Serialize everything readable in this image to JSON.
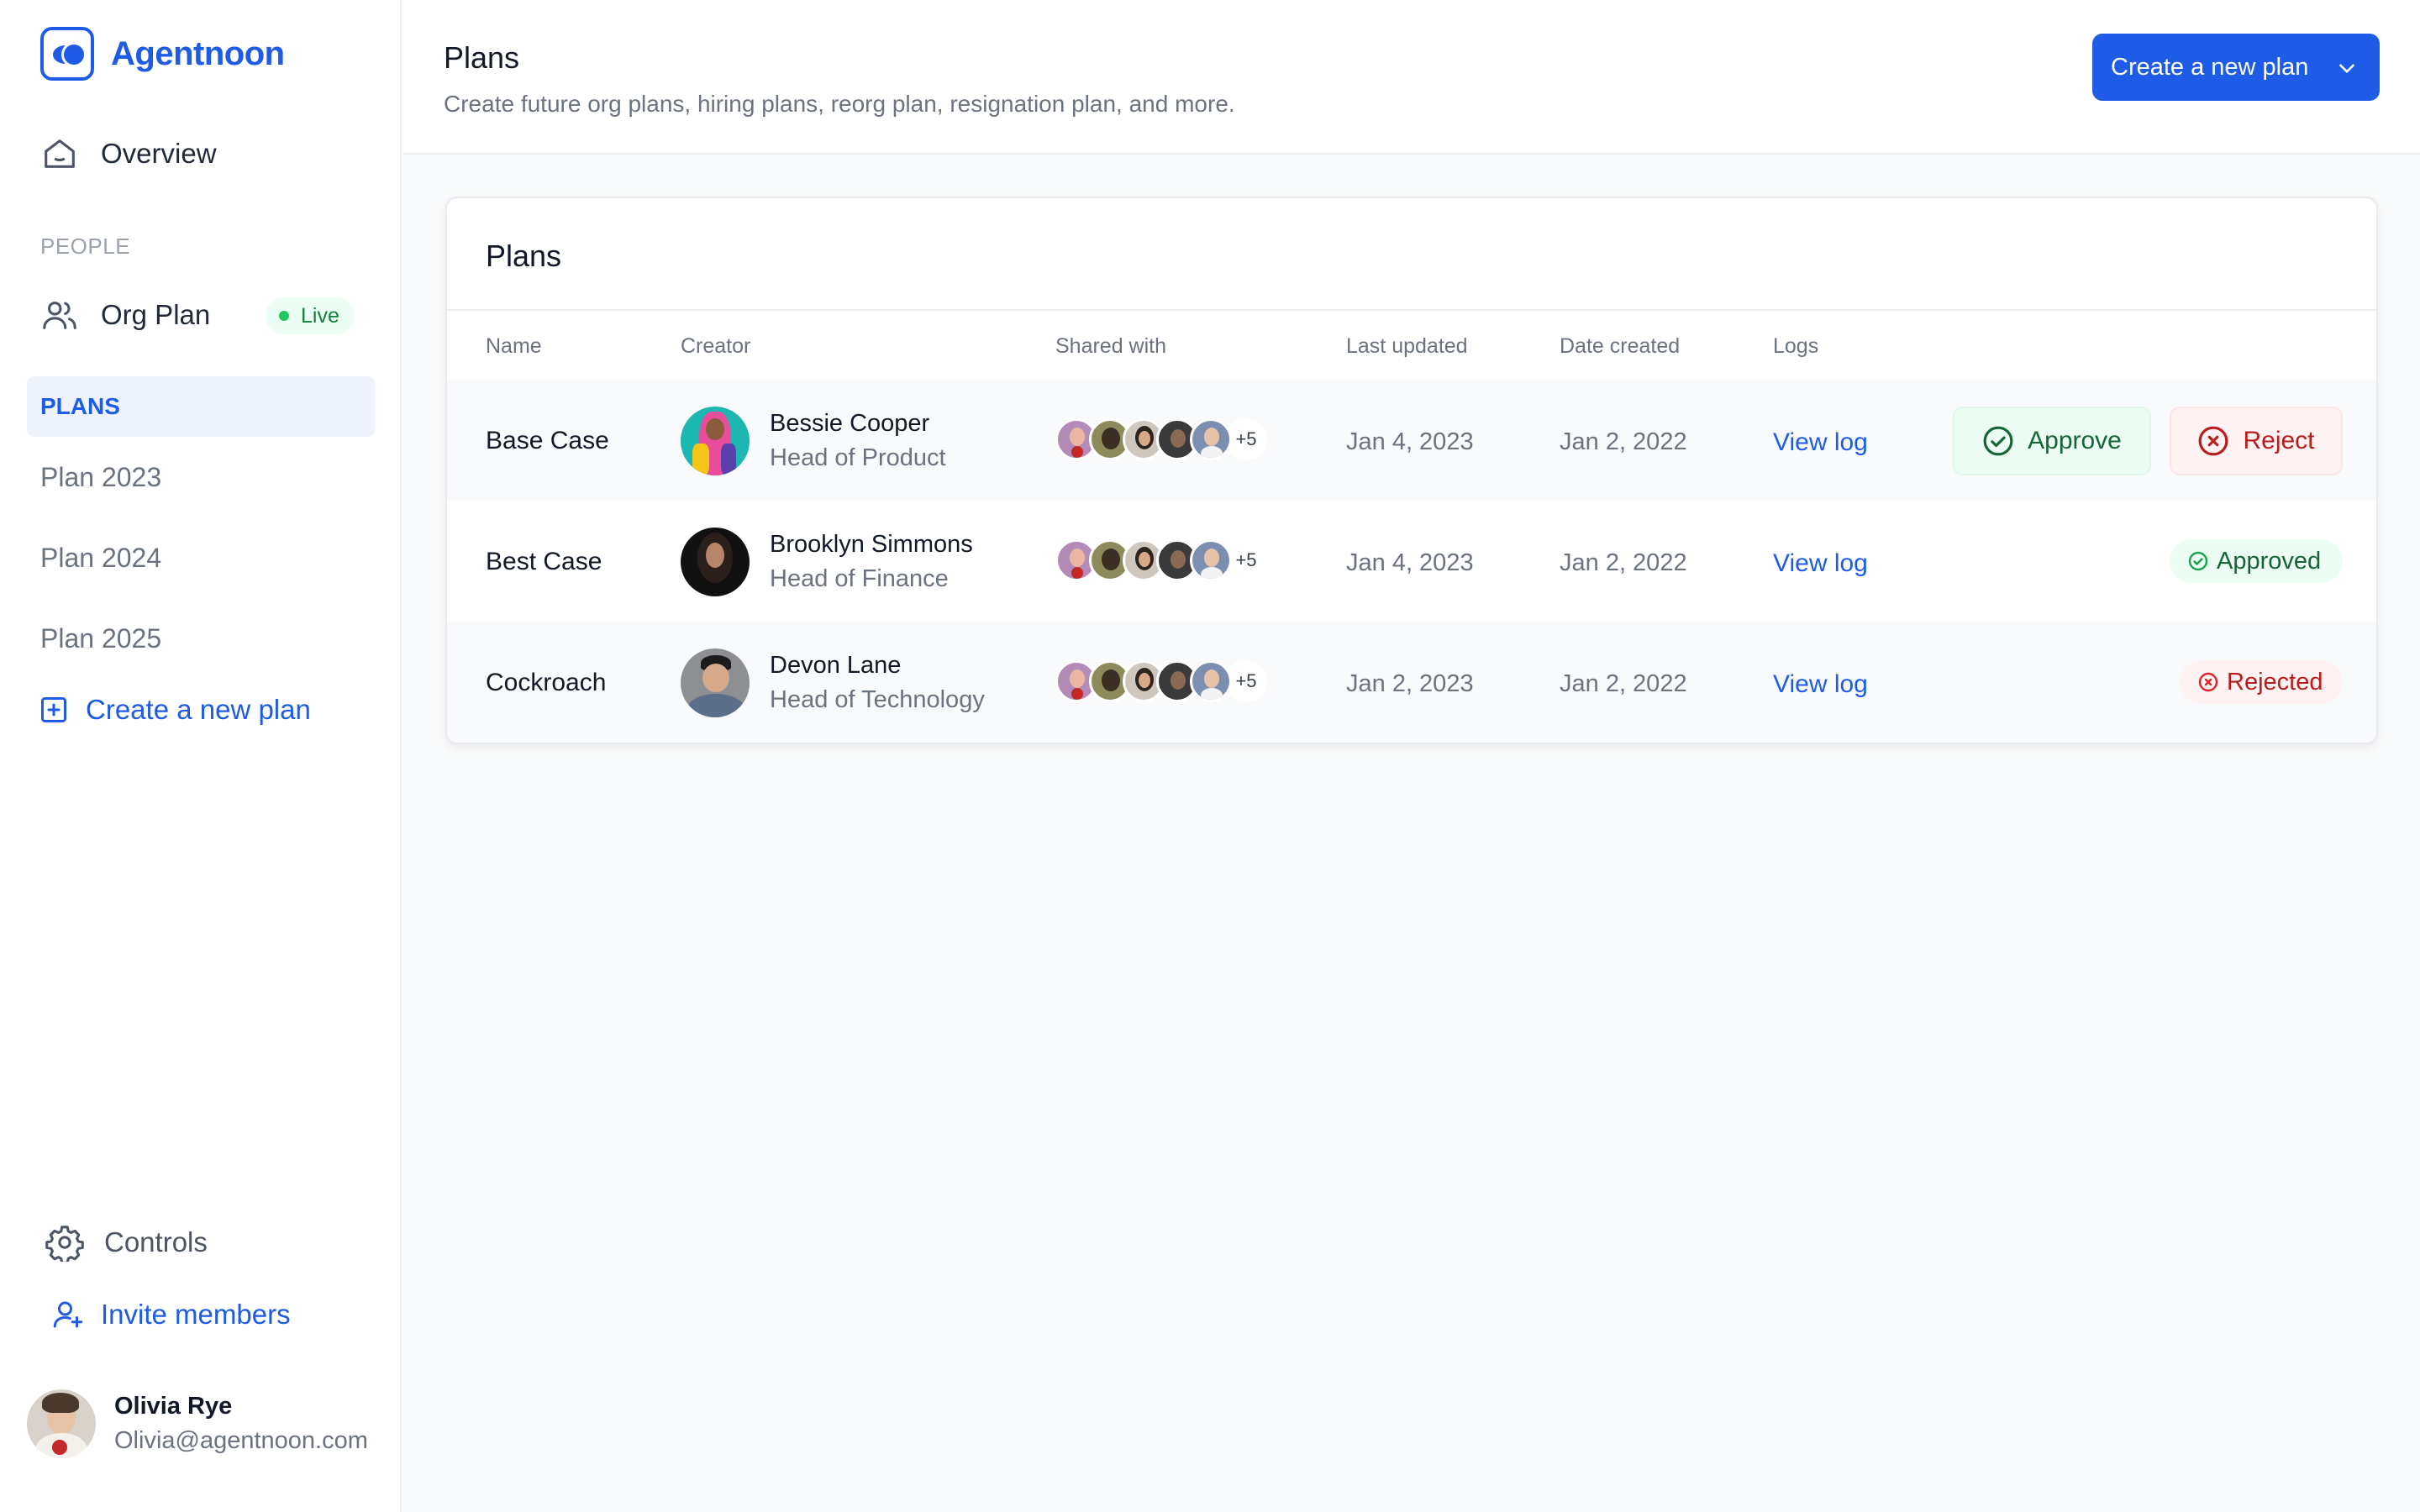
{
  "app": {
    "name": "Agentnoon"
  },
  "sidebar": {
    "overview": "Overview",
    "people_section": "PEOPLE",
    "org_plan": "Org Plan",
    "live_badge": "Live",
    "plans_heading": "PLANS",
    "plans": [
      "Plan 2023",
      "Plan 2024",
      "Plan 2025"
    ],
    "create_plan": "Create a new plan",
    "controls": "Controls",
    "invite": "Invite members",
    "user": {
      "name": "Olivia Rye",
      "email": "Olivia@agentnoon.com"
    }
  },
  "header": {
    "title": "Plans",
    "subtitle": "Create future org plans, hiring plans, reorg plan, resignation plan, and more.",
    "create_button": "Create a new plan"
  },
  "table": {
    "title": "Plans",
    "columns": [
      "Name",
      "Creator",
      "Shared with",
      "Last updated",
      "Date created",
      "Logs"
    ],
    "rows": [
      {
        "name": "Base Case",
        "creator_name": "Bessie Cooper",
        "creator_role": "Head of Product",
        "shared_more": "+5",
        "last_updated": "Jan 4, 2023",
        "date_created": "Jan 2, 2022",
        "log": "View log",
        "approve": "Approve",
        "reject": "Reject"
      },
      {
        "name": "Best Case",
        "creator_name": "Brooklyn Simmons",
        "creator_role": "Head of Finance",
        "shared_more": "+5",
        "last_updated": "Jan 4, 2023",
        "date_created": "Jan 2, 2022",
        "log": "View log",
        "status": "Approved"
      },
      {
        "name": "Cockroach",
        "creator_name": "Devon Lane",
        "creator_role": "Head of Technology",
        "shared_more": "+5",
        "last_updated": "Jan 2, 2023",
        "date_created": "Jan 2, 2022",
        "log": "View log",
        "status": "Rejected"
      }
    ]
  },
  "colors": {
    "accent": "#1e5be6",
    "success": "#166534",
    "danger": "#b91c1c",
    "live": "#22c55e"
  },
  "icons": [
    "logo-icon",
    "home-icon",
    "users-icon",
    "plus-square-icon",
    "gear-icon",
    "user-plus-icon",
    "chevron-down-icon",
    "check-circle-icon",
    "x-circle-icon"
  ]
}
